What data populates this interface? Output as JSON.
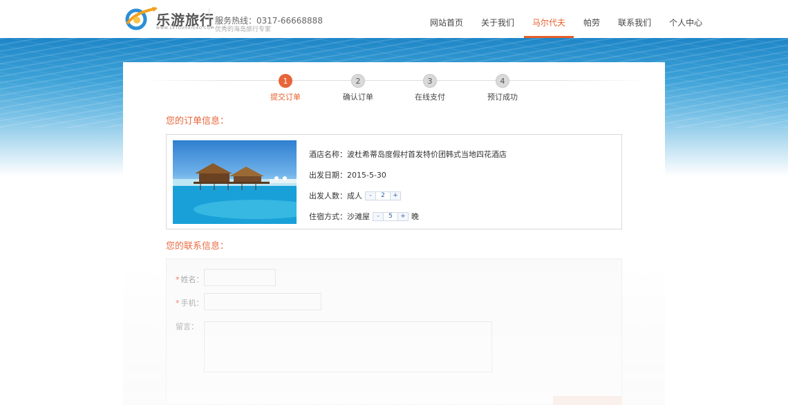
{
  "header": {
    "logo_text": "乐游旅行",
    "logo_sub": "WWW.LEYOUHAIDAO.COM",
    "hotline": "服务热线：0317-66668888",
    "slogan": "优秀的海岛旅行专家",
    "nav": [
      {
        "label": "网站首页"
      },
      {
        "label": "关于我们"
      },
      {
        "label": "马尔代夫"
      },
      {
        "label": "帕劳"
      },
      {
        "label": "联系我们"
      },
      {
        "label": "个人中心"
      }
    ],
    "active_index": 2
  },
  "steps": [
    {
      "num": "1",
      "label": "提交订单"
    },
    {
      "num": "2",
      "label": "确认订单"
    },
    {
      "num": "3",
      "label": "在线支付"
    },
    {
      "num": "4",
      "label": "预订成功"
    }
  ],
  "order": {
    "title": "您的订单信息：",
    "hotel_label": "酒店名称：",
    "hotel_name": "波杜希蒂岛度假村首发特价团韩式当地四花酒店",
    "date_label": "出发日期：",
    "date": "2015-5-30",
    "people_label": "出发人数：",
    "people_type": "成人",
    "people_count": "2",
    "stay_label": "住宿方式：",
    "stay_type": "沙滩屋",
    "stay_count": "5",
    "stay_unit": "晚",
    "minus": "-",
    "plus": "+"
  },
  "contact": {
    "title": "您的联系信息：",
    "name_label": "姓名：",
    "phone_label": "手机：",
    "message_label": "留言：",
    "required_mark": "*"
  },
  "colors": {
    "accent": "#e8653a",
    "sea": "#1e86c7"
  }
}
